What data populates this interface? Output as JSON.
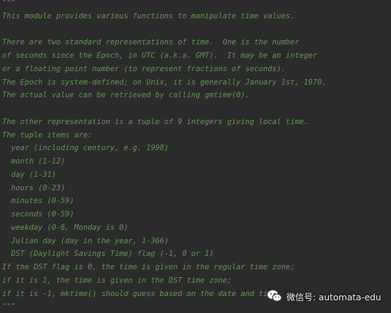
{
  "editor": {
    "lines": [
      "\"\"\"",
      "This module provides various functions to manipulate time values.",
      "",
      "There are two standard representations of time.  One is the number",
      "of seconds since the Epoch, in UTC (a.k.a. GMT).  It may be an integer",
      "or a floating point number (to represent fractions of seconds).",
      "The Epoch is system-defined; on Unix, it is generally January 1st, 1970.",
      "The actual value can be retrieved by calling gmtime(0).",
      "",
      "The other representation is a tuple of 9 integers giving local time.",
      "The tuple items are:",
      "  year (including century, e.g. 1998)",
      "  month (1-12)",
      "  day (1-31)",
      "  hours (0-23)",
      "  minutes (0-59)",
      "  seconds (0-59)",
      "  weekday (0-6, Monday is 0)",
      "  Julian day (day in the year, 1-366)",
      "  DST (Daylight Savings Time) flag (-1, 0 or 1)",
      "If the DST flag is 0, the time is given in the regular time zone;",
      "if it is 1, the time is given in the DST time zone;",
      "if it is -1, mktime() should guess based on the date and time.",
      "\"\"\""
    ],
    "text_color": "#629755",
    "background_color": "#2b2b2b"
  },
  "watermark": {
    "icon": "wechat-icon",
    "text": "微信号: automata-edu"
  }
}
